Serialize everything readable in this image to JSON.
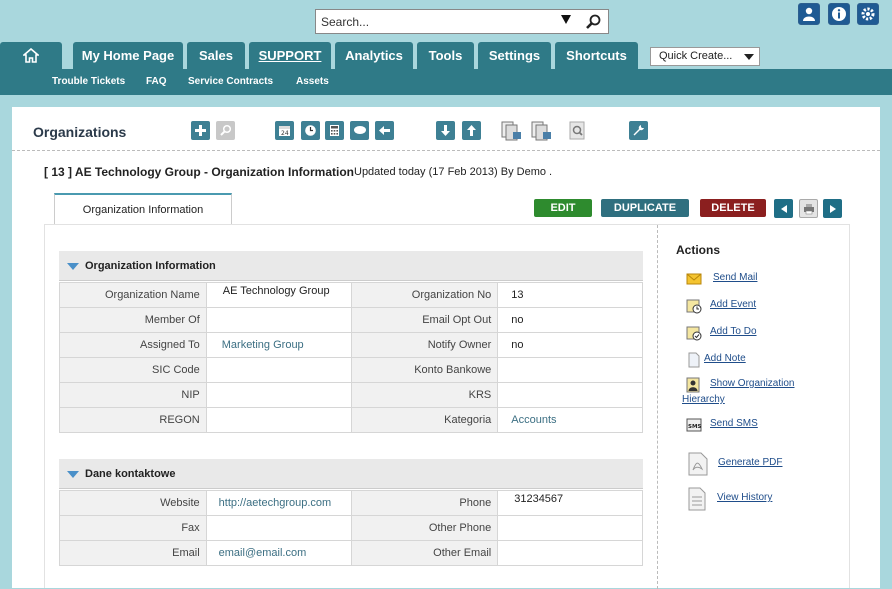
{
  "search": {
    "placeholder": "Search..."
  },
  "nav": {
    "tabs": [
      "My Home Page",
      "Sales",
      "SUPPORT",
      "Analytics",
      "Tools",
      "Settings",
      "Shortcuts"
    ],
    "quick_create": "Quick Create..."
  },
  "subnav": [
    "Trouble Tickets",
    "FAQ",
    "Service Contracts",
    "Assets"
  ],
  "module": {
    "title": "Organizations"
  },
  "record": {
    "title": "[ 13 ] AE Technology Group - Organization Information",
    "updated": "Updated today (17 Feb 2013) By Demo ."
  },
  "tab": {
    "label": "Organization Information"
  },
  "buttons": {
    "edit": "EDIT",
    "duplicate": "DUPLICATE",
    "delete": "DELETE"
  },
  "block1": {
    "title": "Organization Information",
    "rows": [
      [
        "Organization Name",
        "AE Technology Group",
        "Organization No",
        "13"
      ],
      [
        "Member Of",
        "",
        "Email Opt Out",
        "no"
      ],
      [
        "Assigned To",
        "Marketing Group",
        "Notify Owner",
        "no"
      ],
      [
        "SIC Code",
        "",
        "Konto Bankowe",
        ""
      ],
      [
        "NIP",
        "",
        "KRS",
        ""
      ],
      [
        "REGON",
        "",
        "Kategoria",
        "Accounts"
      ]
    ]
  },
  "block2": {
    "title": "Dane kontaktowe",
    "rows": [
      [
        "Website",
        "http://aetechgroup.com",
        "Phone",
        "31234567"
      ],
      [
        "Fax",
        "",
        "Other Phone",
        ""
      ],
      [
        "Email",
        "email@email.com",
        "Other Email",
        ""
      ]
    ]
  },
  "actions": {
    "title": "Actions",
    "items": [
      "Send Mail",
      "Add Event",
      "Add To Do",
      "Add Note",
      "Show Organization",
      "Hierarchy",
      "Send SMS",
      "Generate PDF",
      "View History"
    ]
  },
  "colors": {
    "edit": "#2e8b2e",
    "duplicate": "#2f6f7f",
    "delete": "#8b1f1f",
    "nav": "#2f7a87"
  }
}
